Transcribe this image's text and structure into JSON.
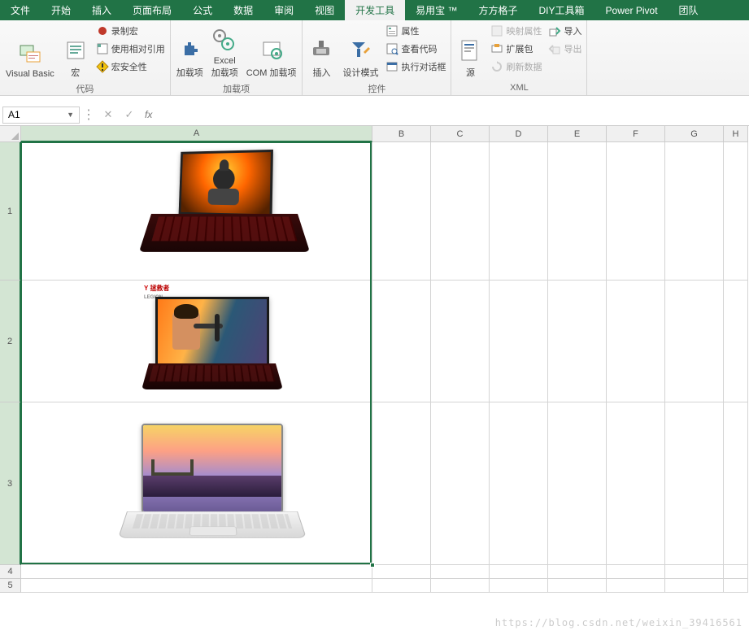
{
  "tabs": [
    "文件",
    "开始",
    "插入",
    "页面布局",
    "公式",
    "数据",
    "审阅",
    "视图",
    "开发工具",
    "易用宝 ™",
    "方方格子",
    "DIY工具箱",
    "Power Pivot",
    "团队"
  ],
  "activeTab": 8,
  "ribbon": {
    "code": {
      "vb": "Visual Basic",
      "macro": "宏",
      "record": "录制宏",
      "relref": "使用相对引用",
      "security": "宏安全性",
      "label": "代码"
    },
    "addins": {
      "addin": "加载项",
      "excel": "Excel\n加载项",
      "com": "COM 加载项",
      "label": "加载项"
    },
    "controls": {
      "insert": "插入",
      "design": "设计模式",
      "props": "属性",
      "viewcode": "查看代码",
      "rundlg": "执行对话框",
      "label": "控件"
    },
    "xml": {
      "source": "源",
      "mapprops": "映射属性",
      "exp": "扩展包",
      "refresh": "刷新数据",
      "import": "导入",
      "export": "导出",
      "label": "XML"
    }
  },
  "namebox": "A1",
  "fx": "fx",
  "cols": {
    "A": 432,
    "B": 72,
    "C": 72,
    "D": 72,
    "E": 72,
    "F": 72,
    "G": 72,
    "H": 30
  },
  "rows": [
    170,
    150,
    200,
    17,
    17
  ],
  "selected": {
    "col": "A",
    "rows": [
      1,
      2,
      3
    ]
  },
  "watermark": "https://blog.csdn.net/weixin_39416561",
  "images": {
    "legion": "LEGION",
    "brand": "拯救者"
  }
}
